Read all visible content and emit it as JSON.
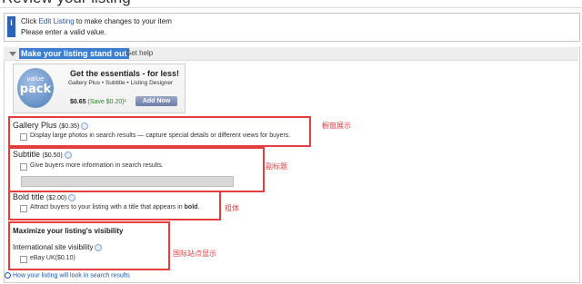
{
  "page": {
    "heading": "Review your listing"
  },
  "info": {
    "line1_pre": "Click ",
    "line1_link": "Edit Listing",
    "line1_post": " to make changes to your item",
    "line2": "Please enter a valid value.",
    "icon": "info-icon"
  },
  "section": {
    "title": "Make your listing stand out",
    "help": "Get help"
  },
  "promo": {
    "logo_top": "value",
    "logo_bottom": "pack",
    "title": "Get the essentials - for less!",
    "subtitle": "Gallery Plus • Subtitle • Listing Designer",
    "price": "$0.65",
    "save": "(Save $0.20)",
    "save_suffix": "¹",
    "button": "Add Now"
  },
  "options": {
    "gallery_plus": {
      "title": "Gallery Plus",
      "price": "($0.35)",
      "desc": "Display large photos in search results — capture special details or different views for buyers.",
      "note": "橱窗展示"
    },
    "subtitle": {
      "title": "Subtitle",
      "price": "($0.50)",
      "desc": "Give buyers more information in search results.",
      "note": "副标题",
      "value": ""
    },
    "bold_title": {
      "title": "Bold title",
      "price": "($2.00)",
      "desc_pre": "Attract buyers to your listing with a title that appears in ",
      "desc_bold": "bold",
      "desc_post": ".",
      "note": "粗体"
    }
  },
  "visibility": {
    "title": "Maximize your listing's visibility",
    "intl_title": "International site visibility",
    "ebay_uk": "eBay UK($0.10)",
    "note": "国际站点显示"
  },
  "footer": {
    "link": "How your listing will look in search results"
  },
  "colors": {
    "annotation": "#e53d3d",
    "link": "#1a55b0",
    "section_title_bg": "#3c7fd2"
  }
}
